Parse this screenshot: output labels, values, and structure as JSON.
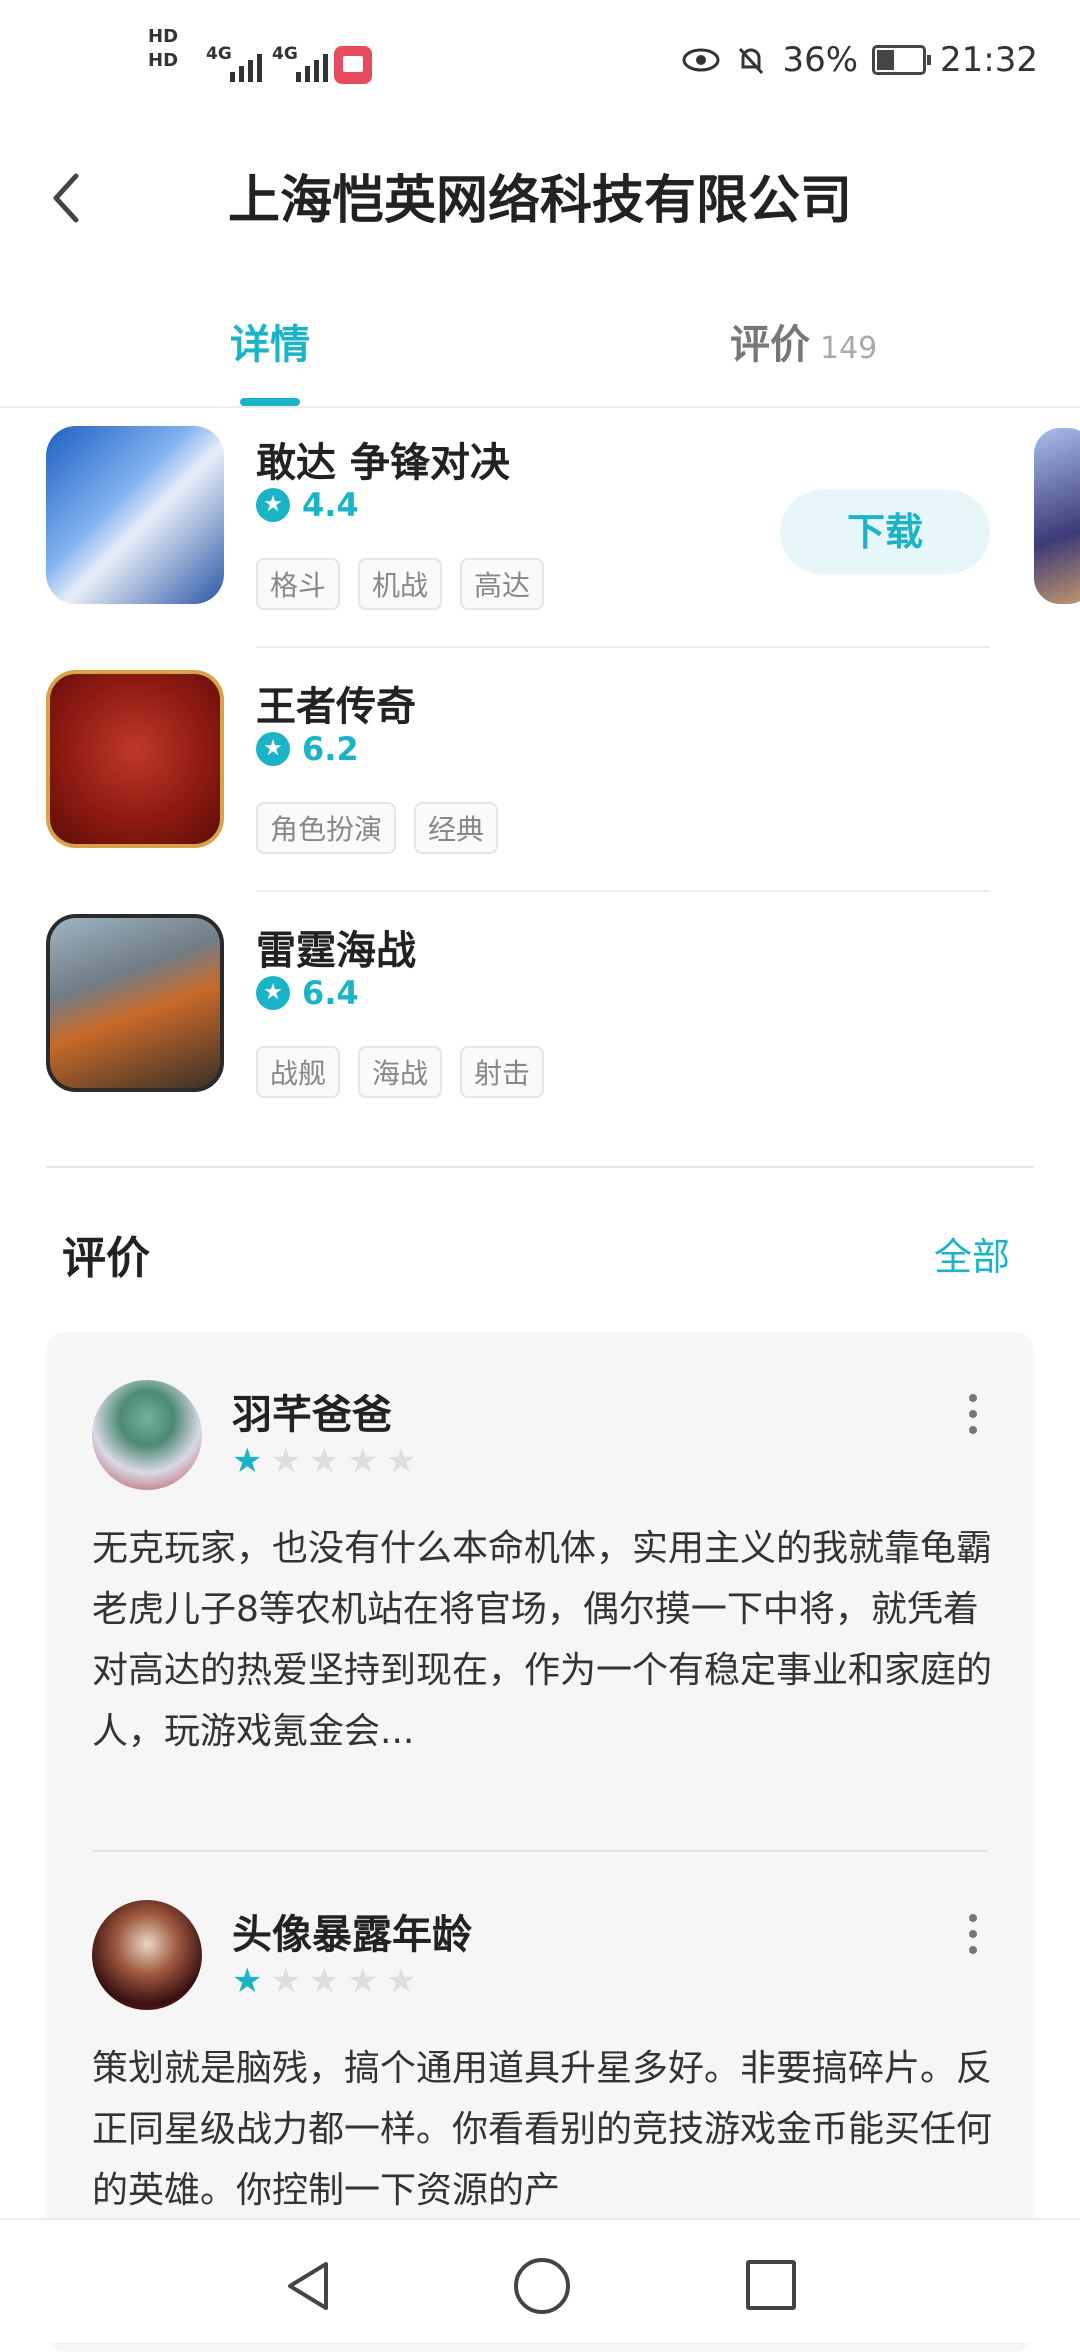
{
  "status_bar": {
    "hd1": "HD",
    "hd2": "HD",
    "net1": "4G",
    "net2": "4G",
    "battery": "36%",
    "time": "21:32"
  },
  "header": {
    "title": "上海恺英网络科技有限公司"
  },
  "tabs": [
    {
      "label": "详情",
      "active": true
    },
    {
      "label": "评价",
      "count": "149",
      "active": false
    }
  ],
  "games": [
    {
      "name": "敢达 争锋对决",
      "rating": "4.4",
      "tags": [
        "格斗",
        "机战",
        "高达"
      ],
      "download_label": "下载"
    },
    {
      "name": "王者传奇",
      "rating": "6.2",
      "tags": [
        "角色扮演",
        "经典"
      ]
    },
    {
      "name": "雷霆海战",
      "rating": "6.4",
      "tags": [
        "战舰",
        "海战",
        "射击"
      ]
    }
  ],
  "reviews_section": {
    "title": "评价",
    "all_label": "全部",
    "items": [
      {
        "user": "羽芊爸爸",
        "stars": 1,
        "text": "无克玩家，也没有什么本命机体，实用主义的我就靠龟霸老虎儿子8等农机站在将官场，偶尔摸一下中将，就凭着对高达的热爱坚持到现在，作为一个有稳定事业和家庭的人，玩游戏氪金会..."
      },
      {
        "user": "头像暴露年龄",
        "stars": 1,
        "text": "策划就是脑残，搞个通用道具升星多好。非要搞碎片。反正同星级战力都一样。你看看别的竞技游戏金币能买任何的英雄。你控制一下资源的产"
      }
    ]
  },
  "colors": {
    "accent": "#1bb4c6",
    "card_bg": "#f6f6f6"
  }
}
